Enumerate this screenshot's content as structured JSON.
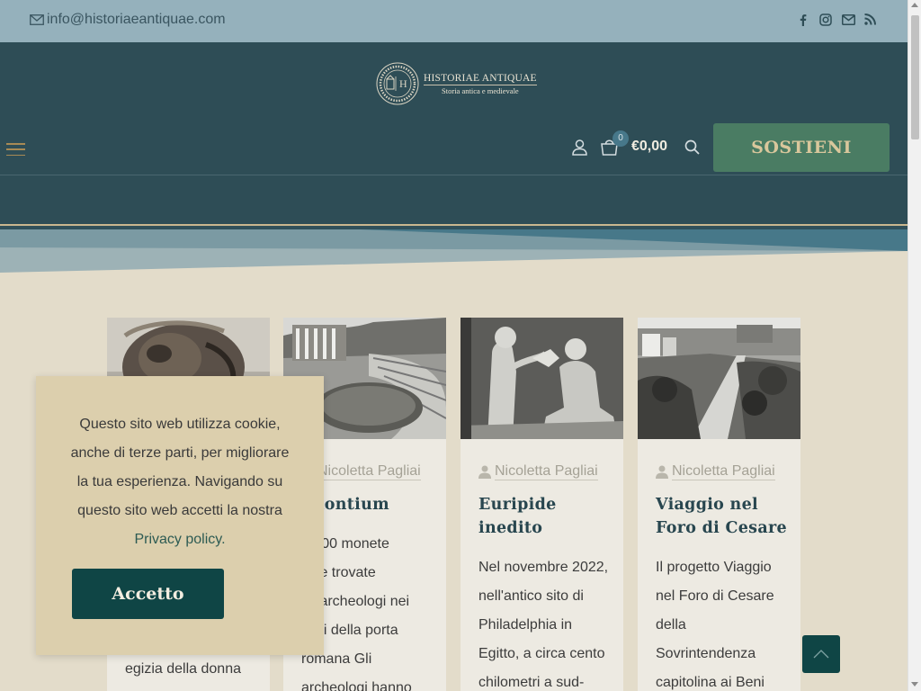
{
  "topbar": {
    "email": "info@historiaeantiquae.com",
    "social_icons": [
      "facebook-icon",
      "instagram-icon",
      "envelope-icon",
      "rss-icon"
    ]
  },
  "header": {
    "logo_initial": "H",
    "logo_name": "HISTORIAE ANTIQUAE",
    "logo_tagline": "Storia antica e medievale",
    "cart_count": "0",
    "cart_total": "€0,00",
    "cta_label": "SOSTIENI"
  },
  "cards": [
    {
      "author": "",
      "title": "",
      "excerpt": [
        "egizia della donna"
      ]
    },
    {
      "author": "Nicoletta Pagliai",
      "title": "imontium",
      "excerpt": [
        "e 500 monete",
        "iche trovate",
        "gli archeologi nei",
        "essi della porta",
        "romana Gli",
        "archeologi hanno"
      ]
    },
    {
      "author": "Nicoletta Pagliai",
      "title": "Euripide inedito",
      "excerpt": [
        "Nel novembre 2022,",
        "nell'antico sito di",
        "Philadelphia in",
        "Egitto, a circa cento",
        "chilometri a sud-"
      ]
    },
    {
      "author": "Nicoletta Pagliai",
      "title": "Viaggio nel Foro di Cesare",
      "excerpt": [
        "Il progetto Viaggio",
        "nel Foro di Cesare",
        "della",
        "Sovrintendenza",
        "capitolina ai Beni"
      ]
    }
  ],
  "cookie": {
    "text": "Questo sito web utilizza cookie, anche di terze parti, per migliorare la tua esperienza. Navigando su questo sito web accetti la nostra",
    "link": "Privacy policy",
    "link_suffix": ".",
    "accept_label": "Accetto"
  },
  "colors": {
    "topbar": "#95b1bc",
    "header": "#2e4d56",
    "page_bg": "#e3dcca",
    "cta": "#4a7c63",
    "accept_button": "#0f4545"
  }
}
